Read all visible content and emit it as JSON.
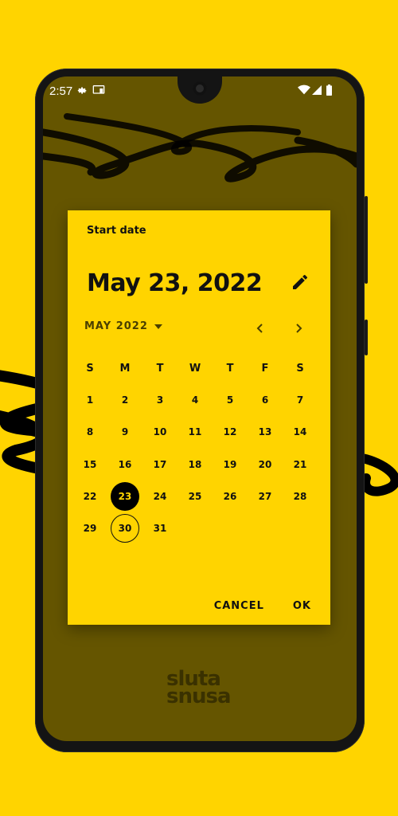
{
  "status_bar": {
    "time": "2:57",
    "left_icons": [
      "settings-icon",
      "cast-icon"
    ],
    "right_icons": [
      "wifi-icon",
      "signal-icon",
      "battery-icon"
    ]
  },
  "dialog": {
    "title": "Start date",
    "selected_date_label": "May 23, 2022",
    "month_label": "MAY 2022",
    "weekdays": [
      "S",
      "M",
      "T",
      "W",
      "T",
      "F",
      "S"
    ],
    "weeks": [
      [
        "",
        "",
        "",
        "",
        "",
        "",
        ""
      ],
      [
        "1",
        "2",
        "3",
        "4",
        "5",
        "6",
        "7"
      ],
      [
        "8",
        "9",
        "10",
        "11",
        "12",
        "13",
        "14"
      ],
      [
        "15",
        "16",
        "17",
        "18",
        "19",
        "20",
        "21"
      ],
      [
        "22",
        "23",
        "24",
        "25",
        "26",
        "27",
        "28"
      ],
      [
        "29",
        "30",
        "31",
        "",
        "",
        "",
        ""
      ]
    ],
    "selected_day": "23",
    "today_day": "30",
    "cancel_label": "CANCEL",
    "ok_label": "OK"
  },
  "logo": {
    "line1": "sluta",
    "line2": "snusa"
  },
  "colors": {
    "accent": "#FFD400",
    "scrim": "#655500",
    "selected_bg": "#000000"
  }
}
